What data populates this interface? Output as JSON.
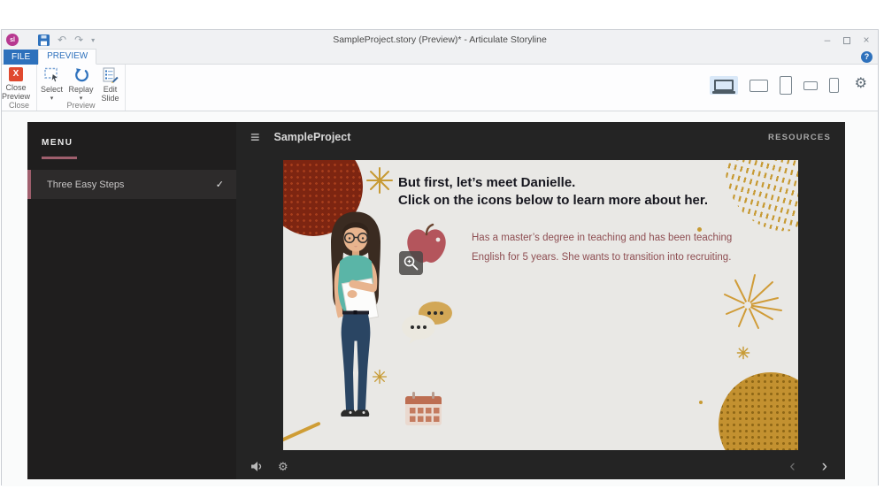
{
  "titlebar": {
    "title": "SampleProject.story (Preview)* - Articulate Storyline",
    "logo_text": "sl"
  },
  "tabs": {
    "file": "FILE",
    "preview": "PREVIEW"
  },
  "ribbon": {
    "close_preview_label": "Close Preview",
    "select_label": "Select",
    "replay_label": "Replay",
    "edit_slide_label": "Edit Slide",
    "close_group_label": "Close",
    "preview_group_label": "Preview"
  },
  "player": {
    "menu_title": "MENU",
    "menu_item": "Three Easy Steps",
    "project_title": "SampleProject",
    "resources_label": "RESOURCES"
  },
  "slide": {
    "heading_line1": "But first, let’s meet Danielle.",
    "heading_line2": "Click on the icons below to learn more about her.",
    "body_line1": "Has a master’s degree in teaching and has been teaching",
    "body_line2": "English for 5 years. She wants to transition into recruiting."
  },
  "icons": {
    "hamburger": "≡",
    "check": "✓",
    "prev": "‹",
    "next": "›",
    "gear": "⚙",
    "help": "?",
    "minimize": "–",
    "close_window": "×",
    "dropdown": "▾",
    "undo": "↶",
    "redo": "↷",
    "close_preview_x": "X"
  },
  "colors": {
    "accent_blue": "#2e71bc",
    "accent_pink": "#9f5f6d",
    "close_red": "#e0492f",
    "slide_gold": "#c79a33",
    "slide_dark_red": "#7d2511",
    "slide_mustard": "#c39130",
    "body_text_red": "#8e4e52",
    "player_bg": "#242424"
  }
}
